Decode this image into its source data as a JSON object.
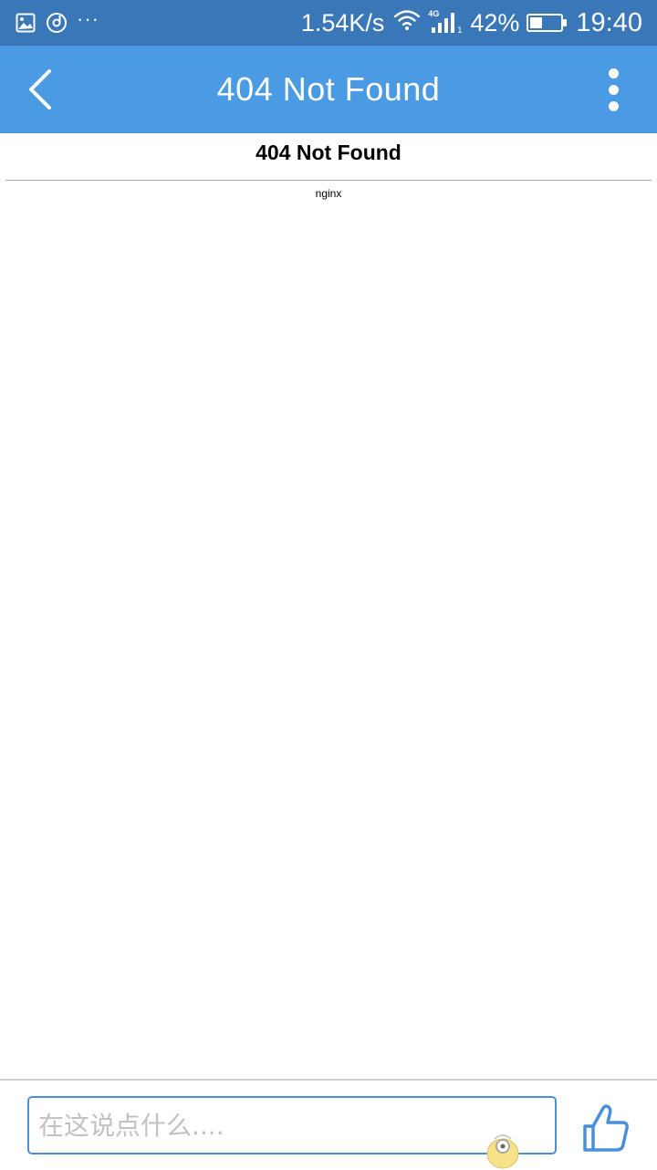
{
  "status_bar": {
    "net_speed": "1.54K/s",
    "network_type": "4G",
    "battery_percent": "42%",
    "battery_level": 0.42,
    "time": "19:40",
    "more": "···",
    "icons": [
      "gallery-icon",
      "music-icon",
      "wifi-icon",
      "signal-icon",
      "battery-icon"
    ]
  },
  "app_bar": {
    "title": "404 Not Found",
    "icons": [
      "back-chevron-icon",
      "more-vertical-icon"
    ]
  },
  "page": {
    "heading": "404 Not Found",
    "server": "nginx"
  },
  "bottom_bar": {
    "comment_placeholder": "在这说点什么....",
    "icons": [
      "thumbs-up-icon",
      "mascot-icon"
    ]
  },
  "colors": {
    "status_bar_bg": "#3a77b8",
    "app_bar_bg": "#4a9ae4",
    "input_border": "#4a90d9",
    "like_icon": "#4a90d9"
  }
}
